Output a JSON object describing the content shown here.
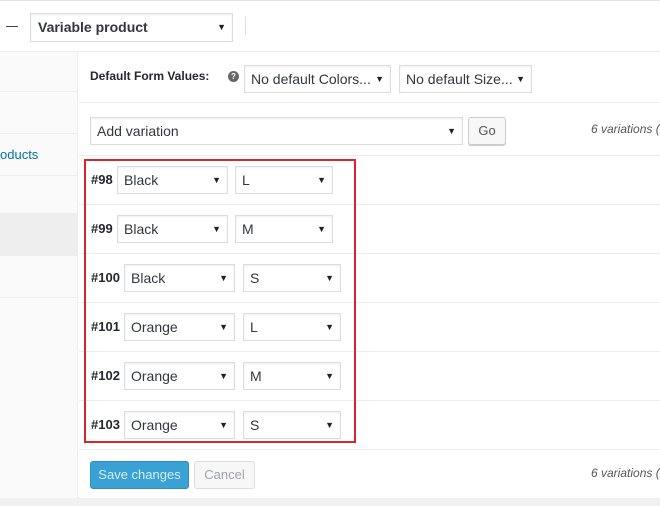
{
  "product_type": {
    "value": "Variable product"
  },
  "sidebar": {
    "partial_label": "oducts"
  },
  "default_form": {
    "label": "Default Form Values:",
    "help_icon": "?",
    "colors_value": "No default Colors...",
    "size_value": "No default Size..."
  },
  "actions": {
    "select_value": "Add variation",
    "go_label": "Go",
    "count_text": "6 variations ("
  },
  "variations": [
    {
      "id": "#98",
      "color": "Black",
      "size": "L"
    },
    {
      "id": "#99",
      "color": "Black",
      "size": "M"
    },
    {
      "id": "#100",
      "color": "Black",
      "size": "S"
    },
    {
      "id": "#101",
      "color": "Orange",
      "size": "L"
    },
    {
      "id": "#102",
      "color": "Orange",
      "size": "M"
    },
    {
      "id": "#103",
      "color": "Orange",
      "size": "S"
    }
  ],
  "footer": {
    "save_label": "Save changes",
    "cancel_label": "Cancel",
    "count_text": "6 variations ("
  },
  "colors": {
    "highlight": "#d9262e",
    "primary": "#3aa1d5",
    "link": "#0073aa"
  }
}
